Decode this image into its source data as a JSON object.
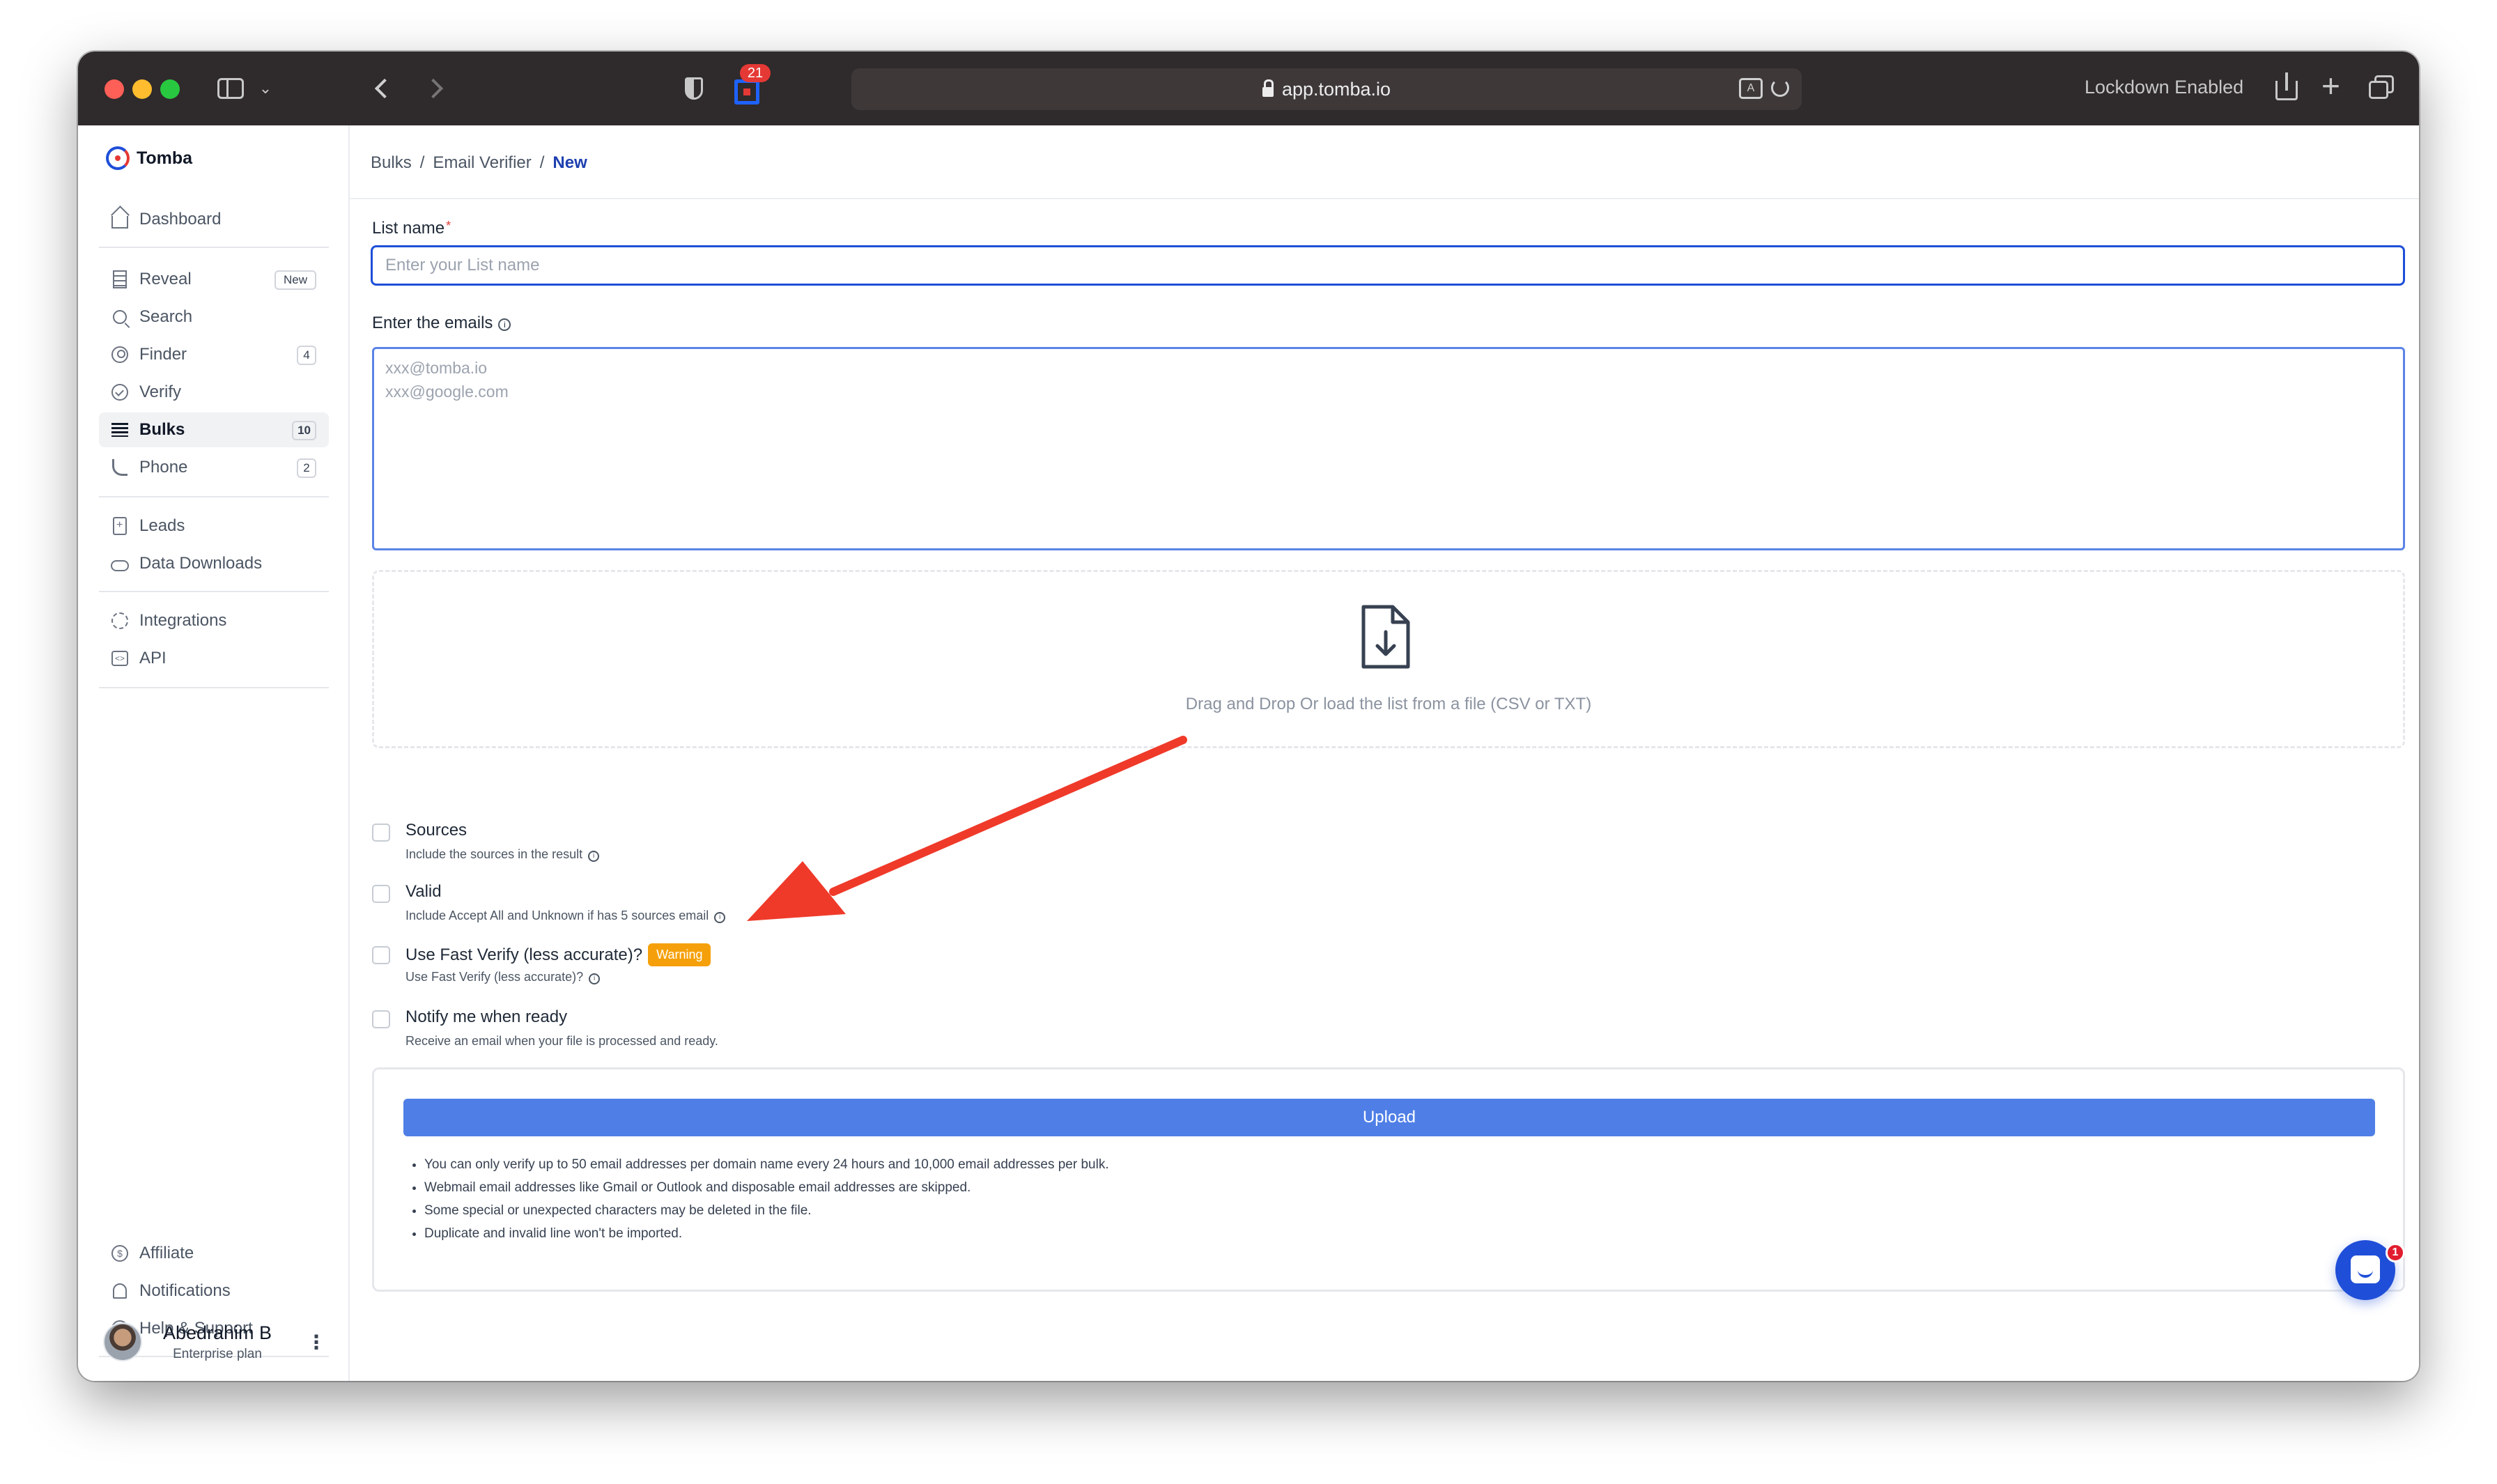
{
  "browser": {
    "url": "app.tomba.io",
    "extension_badge": "21",
    "lockdown_text": "Lockdown Enabled"
  },
  "app": {
    "name": "Tomba"
  },
  "sidebar": {
    "items": [
      {
        "label": "Dashboard",
        "icon": "home-icon"
      },
      {
        "label": "Reveal",
        "icon": "building-icon",
        "badge": "New"
      },
      {
        "label": "Search",
        "icon": "search-icon"
      },
      {
        "label": "Finder",
        "icon": "user-circle-icon",
        "badge": "4"
      },
      {
        "label": "Verify",
        "icon": "check-circle-icon"
      },
      {
        "label": "Bulks",
        "icon": "list-icon",
        "badge": "10",
        "active": true
      },
      {
        "label": "Phone",
        "icon": "phone-icon",
        "badge": "2"
      },
      {
        "label": "Leads",
        "icon": "document-plus-icon"
      },
      {
        "label": "Data Downloads",
        "icon": "cloud-icon"
      },
      {
        "label": "Integrations",
        "icon": "plug-icon"
      },
      {
        "label": "API",
        "icon": "code-icon"
      }
    ],
    "footer_items": [
      {
        "label": "Affiliate",
        "icon": "dollar-icon"
      },
      {
        "label": "Notifications",
        "icon": "bell-icon"
      },
      {
        "label": "Help & Support",
        "icon": "help-icon"
      }
    ],
    "user": {
      "name": "Abedrahim B",
      "plan": "Enterprise plan"
    }
  },
  "breadcrumb": [
    "Bulks",
    "Email Verifier",
    "New"
  ],
  "form": {
    "list_name_label": "List name",
    "list_name_required": "*",
    "list_name_placeholder": "Enter your List name",
    "list_name_value": "",
    "emails_label": "Enter the emails",
    "emails_placeholder": "xxx@tomba.io\nxxx@google.com",
    "dropzone_text": "Drag and Drop Or load the list from a file (CSV or TXT)",
    "options": [
      {
        "title": "Sources",
        "subtitle": "Include the sources in the result",
        "checked": false
      },
      {
        "title": "Valid",
        "subtitle": "Include Accept All and Unknown if has 5 sources email",
        "checked": false
      },
      {
        "title": "Use Fast Verify (less accurate)?",
        "subtitle": "Use Fast Verify (less accurate)?",
        "badge": "Warning",
        "checked": false
      },
      {
        "title": "Notify me when ready",
        "subtitle": "Receive an email when your file is processed and ready.",
        "checked": false
      }
    ],
    "upload_label": "Upload",
    "notes": [
      "You can only verify up to 50 email addresses per domain name every 24 hours and 10,000 email addresses per bulk.",
      "Webmail email addresses like Gmail or Outlook and disposable email addresses are skipped.",
      "Some special or unexpected characters may be deleted in the file.",
      "Duplicate and invalid line won't be imported."
    ]
  },
  "chat": {
    "badge": "1"
  },
  "colors": {
    "primary": "#1e4fd8",
    "upload_button": "#4f7fe6",
    "warning": "#f5a00a",
    "annotation_arrow": "#ef3a2a"
  }
}
